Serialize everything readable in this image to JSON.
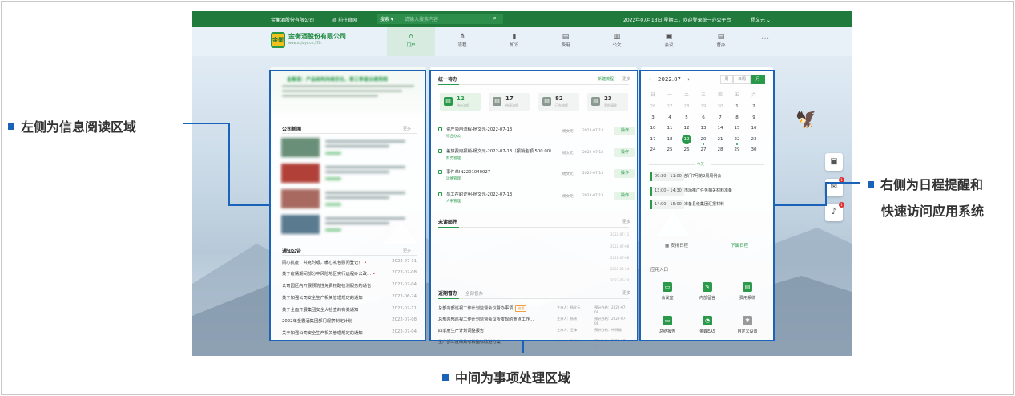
{
  "annotations": {
    "left": "左侧为信息阅读区域",
    "right_line1": "右侧为日程提醒和",
    "right_line2": "快速访问应用系统",
    "bottom": "中间为事项处理区域"
  },
  "topbar": {
    "company": "金衡酒股份有限公司",
    "site_link": "前往官网",
    "search_scope": "搜索",
    "search_placeholder": "请输入搜索内容",
    "date_greeting": "2022年07月13日 星期三，欢迎登录统一办公平台",
    "user": "杨文元"
  },
  "brand": {
    "logo_char": "金衡",
    "name": "金衡酒股份有限公司",
    "sub": "www.xxjiuye.co.,LTD."
  },
  "nav": [
    {
      "label": "门户",
      "icon": "home-icon",
      "glyph": "⌂"
    },
    {
      "label": "流程",
      "icon": "flow-icon",
      "glyph": "⋔"
    },
    {
      "label": "知识",
      "icon": "book-icon",
      "glyph": "▮"
    },
    {
      "label": "费用",
      "icon": "expense-icon",
      "glyph": "▤"
    },
    {
      "label": "公文",
      "icon": "document-icon",
      "glyph": "▥"
    },
    {
      "label": "会议",
      "icon": "meeting-icon",
      "glyph": "▣"
    },
    {
      "label": "督办",
      "icon": "supervise-icon",
      "glyph": "▤"
    },
    {
      "label": "",
      "icon": "more-icon",
      "glyph": "•••"
    }
  ],
  "left": {
    "banner_title": "金衡酒：产品结构持续优化，第三季度业绩亮眼",
    "news_title": "公司新闻",
    "more": "更多 ›",
    "notice_title": "通知公告",
    "notices": [
      {
        "text": "同心抗疫，共克时艰，暖心礼包慰问登记！",
        "date": "2022-07-11",
        "new": true
      },
      {
        "text": "关于疫情期间部分中风险地区实行远程办公政…",
        "date": "2022-07-08",
        "new": true
      },
      {
        "text": "公司园区内开展预防性免费核酸检测服务的通告",
        "date": "2022-07-04",
        "new": false
      },
      {
        "text": "关于加强公司安全生产相关管理规定的通知",
        "date": "2022-06-24",
        "new": false
      },
      {
        "text": "关于全面开展集团安全大检查的有关通知",
        "date": "2022-07-11",
        "new": false
      },
      {
        "text": "2022年金霸酒集团部门观察制定计划",
        "date": "2022-07-08",
        "new": false
      },
      {
        "text": "关于加强公司安全生产相关管理规定的通知",
        "date": "2022-07-04",
        "new": false
      }
    ]
  },
  "mid": {
    "todo_title": "统一待办",
    "new_flow": "新建流程",
    "more": "更多",
    "stats": [
      {
        "num": "12",
        "label": "待办流程"
      },
      {
        "num": "17",
        "label": "待阅流程"
      },
      {
        "num": "82",
        "label": "已办流程"
      },
      {
        "num": "23",
        "label": "我的请求"
      }
    ],
    "todos": [
      {
        "title": "资产领用流程-杨文元-2022-07-13",
        "tag": "综合办公",
        "user": "杨文元",
        "date": "2022-07-13",
        "action": "操作"
      },
      {
        "title": "差旅费用报销-杨文元-2022-07-13（报销金额:500.00）",
        "tag": "财务管理",
        "user": "杨文元",
        "date": "2022-07-13",
        "action": "操作"
      },
      {
        "title": "事件单IN2201040027",
        "tag": "运维管理",
        "user": "杨文元",
        "date": "2022-07-13",
        "action": "操作"
      },
      {
        "title": "员工在职证明-杨文元-2022-07-13",
        "tag": "人事管理",
        "user": "杨文元",
        "date": "2022-07-13",
        "action": "操作"
      }
    ],
    "mail_title": "未读邮件",
    "mail_dates": [
      "2022-07-11",
      "2022-07-08",
      "2022-07-08",
      "2022-06-24",
      "2022-06-24"
    ],
    "task_tab1": "近期督办",
    "task_tab2": "全部督办",
    "tasks": [
      {
        "title": "总部内部巡视工作计划监督会议督办事项",
        "overdue": "逾期",
        "owner": "主办人：杨文元",
        "due": "预计办结：2022-07-08"
      },
      {
        "title": "总部内部巡视工作计划监督会议所发现的重点工作…",
        "overdue": "",
        "owner": "主办人：杨玮",
        "due": "预计办结：2022-07-08"
      },
      {
        "title": "四季度生产计划调整报告",
        "overdue": "",
        "owner": "主办人：王锋",
        "due": "预计办结：待明确"
      },
      {
        "title": "生产部年度绩效考核指标改进方案",
        "overdue": "",
        "owner": "主办人：张洪林",
        "due": "预计办结：2022-07-08"
      }
    ]
  },
  "right": {
    "month": "2022.07",
    "views": [
      "周",
      "日周",
      "月"
    ],
    "weekdays": [
      "日",
      "一",
      "二",
      "三",
      "四",
      "五",
      "六"
    ],
    "days": [
      "26",
      "27",
      "28",
      "29",
      "30",
      "1",
      "2",
      "3",
      "4",
      "5",
      "6",
      "7",
      "8",
      "9",
      "10",
      "11",
      "12",
      "13",
      "14",
      "15",
      "16",
      "17",
      "18",
      "19",
      "20",
      "21",
      "22",
      "23",
      "24",
      "25",
      "26",
      "27",
      "28",
      "29",
      "30"
    ],
    "today_label": "今天",
    "schedules": [
      {
        "time": "09:30 - 11:00",
        "text": "部门7月第2周周例会"
      },
      {
        "time": "13:00 - 14:30",
        "text": "市场推广任务相关材料准备"
      },
      {
        "time": "14:00 - 15:00",
        "text": "准备县级集团汇报材料"
      }
    ],
    "btn_schedule": "安排日程",
    "btn_subordinate": "下属日程",
    "apps_title": "应用入口",
    "apps": [
      {
        "label": "会议室",
        "icon": "meeting-room-icon"
      },
      {
        "label": "内部留言",
        "icon": "message-icon"
      },
      {
        "label": "费用系统",
        "icon": "expense-system-icon"
      },
      {
        "label": "总结报告",
        "icon": "report-icon"
      },
      {
        "label": "金蝶EAS",
        "icon": "eas-icon"
      },
      {
        "label": "自定义设置",
        "icon": "settings-icon"
      }
    ],
    "side_badges": [
      "1",
      "1"
    ]
  }
}
